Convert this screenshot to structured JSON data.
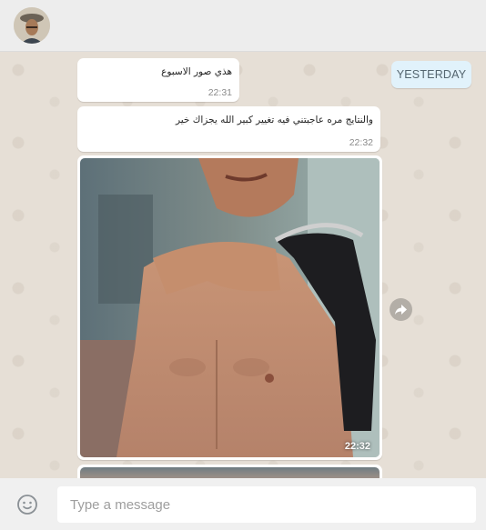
{
  "header": {
    "avatar_icon": "contact-avatar"
  },
  "chat": {
    "day_label": "YESTERDAY",
    "messages": [
      {
        "text": "هذي صور الاسبوع",
        "time": "22:31"
      },
      {
        "text": "والنتايج مره عاجبتني فيه تغيير كبير الله يجزاك خير",
        "time": "22:32"
      },
      {
        "type": "image",
        "time": "22:32"
      }
    ],
    "highlight_color": "#e03030"
  },
  "composer": {
    "emoji_icon": "smiley-icon",
    "placeholder": "Type a message"
  }
}
